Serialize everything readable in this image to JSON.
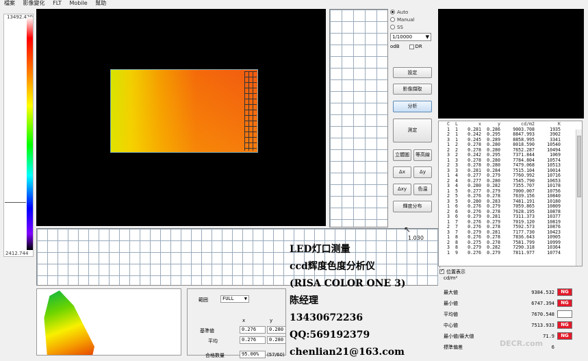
{
  "menu": {
    "items": [
      "檔案",
      "影像變化",
      "FLT",
      "Mobile",
      "幫助"
    ]
  },
  "scale": {
    "max": "13492.420",
    "min": "2412.744"
  },
  "controls": {
    "radios": [
      {
        "label": "Auto",
        "selected": true
      },
      {
        "label": "Manual",
        "selected": false
      },
      {
        "label": "SS",
        "selected": false
      }
    ],
    "exposure": "1/10000",
    "odb_label": "odB",
    "dr_label": "DR"
  },
  "buttons": {
    "settings": "設定",
    "image_capture": "影像擷取",
    "analyze": "分析",
    "measure": "測定",
    "solid": "立體圖",
    "contour": "等高線",
    "dx": "Δx",
    "dy": "Δy",
    "dxy": "Δxy",
    "color": "色温",
    "distribution": "輝度分布"
  },
  "readout": "1.030",
  "table": {
    "headers": [
      "C",
      "L",
      "x",
      "y",
      "cd/m2",
      "K"
    ],
    "rows": [
      [
        "1",
        "1",
        "0.281",
        "0.286",
        "9003.708",
        "1935"
      ],
      [
        "2",
        "1",
        "0.242",
        "0.295",
        "8847.993",
        "3902"
      ],
      [
        "3",
        "1",
        "0.245",
        "0.289",
        "8858.995",
        "3341"
      ],
      [
        "1",
        "2",
        "0.278",
        "0.280",
        "8018.590",
        "10540"
      ],
      [
        "2",
        "2",
        "0.278",
        "0.280",
        "7652.287",
        "10494"
      ],
      [
        "3",
        "2",
        "0.242",
        "0.295",
        "7371.844",
        "1069"
      ],
      [
        "1",
        "3",
        "0.278",
        "0.280",
        "7784.804",
        "10574"
      ],
      [
        "2",
        "3",
        "0.278",
        "0.280",
        "7479.068",
        "10513"
      ],
      [
        "3",
        "3",
        "0.281",
        "0.284",
        "7515.104",
        "10014"
      ],
      [
        "1",
        "4",
        "0.277",
        "0.279",
        "7760.992",
        "10716"
      ],
      [
        "2",
        "4",
        "0.277",
        "0.280",
        "7545.790",
        "10653"
      ],
      [
        "3",
        "4",
        "0.280",
        "0.282",
        "7355.707",
        "10178"
      ],
      [
        "1",
        "5",
        "0.277",
        "0.279",
        "7000.007",
        "10756"
      ],
      [
        "2",
        "5",
        "0.276",
        "0.278",
        "7639.156",
        "10840"
      ],
      [
        "3",
        "5",
        "0.280",
        "0.283",
        "7481.191",
        "10180"
      ],
      [
        "1",
        "6",
        "0.276",
        "0.279",
        "7059.865",
        "10809"
      ],
      [
        "2",
        "6",
        "0.276",
        "0.278",
        "7628.195",
        "10878"
      ],
      [
        "3",
        "6",
        "0.279",
        "0.281",
        "7311.373",
        "10377"
      ],
      [
        "1",
        "7",
        "0.276",
        "0.279",
        "7019.120",
        "10819"
      ],
      [
        "2",
        "7",
        "0.276",
        "0.278",
        "7592.573",
        "10876"
      ],
      [
        "3",
        "7",
        "0.279",
        "0.281",
        "7177.730",
        "10423"
      ],
      [
        "1",
        "8",
        "0.276",
        "0.278",
        "7836.643",
        "10905"
      ],
      [
        "2",
        "8",
        "0.275",
        "0.278",
        "7581.799",
        "10999"
      ],
      [
        "3",
        "8",
        "0.279",
        "0.282",
        "7290.318",
        "10364"
      ],
      [
        "1",
        "9",
        "0.276",
        "0.279",
        "7811.977",
        "10774"
      ]
    ]
  },
  "stats": {
    "show_label": "位置表示",
    "unit": "cd/m²",
    "rows": [
      {
        "label": "最大値",
        "value": "9384.532",
        "flag": "NG"
      },
      {
        "label": "最小値",
        "value": "6747.394",
        "flag": "NG"
      },
      {
        "label": "平均値",
        "value": "7670.548",
        "flag": ""
      },
      {
        "label": "中心値",
        "value": "7513.933",
        "flag": "NG"
      },
      {
        "label": "最小値/最大値",
        "value": "71.9",
        "flag": "NG"
      },
      {
        "label": "標準偏差",
        "value": "6",
        "flag": ""
      }
    ]
  },
  "range": {
    "label": "範囲",
    "mode": "FULL",
    "col_x": "x",
    "col_y": "y",
    "standard_label": "基準値",
    "standard_x": "0.276",
    "standard_y": "0.280",
    "average_label": "平均",
    "average_x": "0.276",
    "average_y": "0.280",
    "ratio_label": "合格数量",
    "ratio_value": "95.00%",
    "ratio_count": "(57/60)"
  },
  "overlay": {
    "lines": [
      "LED灯口测量",
      "ccd辉度色度分析仪",
      "(RISA COLOR ONE 3)",
      "陈经理",
      "13430672236",
      "QQ:569192379",
      "chenlian21@163.com"
    ]
  },
  "watermark": "DECR.com"
}
